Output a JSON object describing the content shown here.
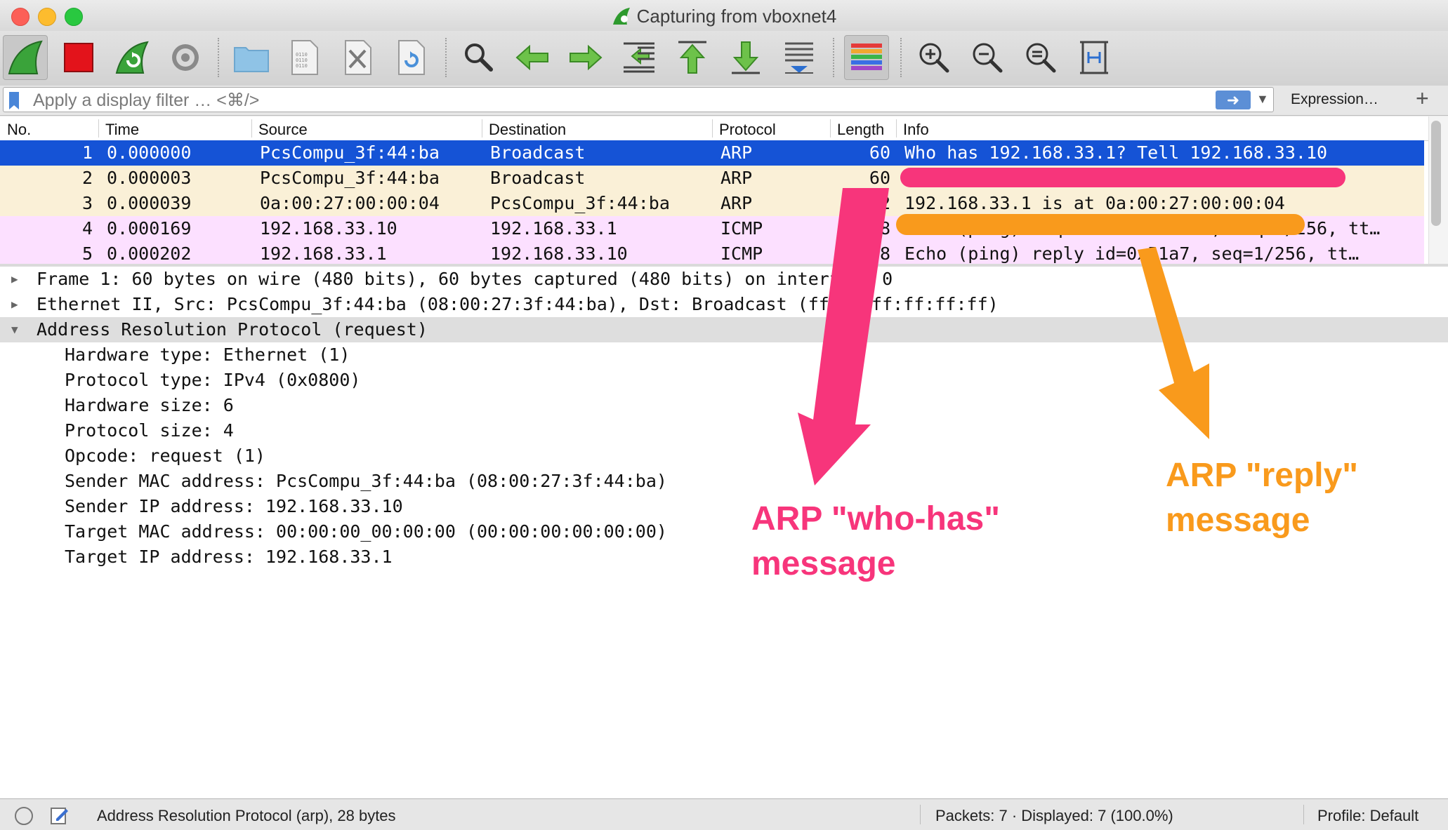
{
  "window": {
    "title": "Capturing from vboxnet4"
  },
  "toolbar": {
    "buttons": [
      "start-capture",
      "stop-capture",
      "restart-capture",
      "capture-options",
      "open-file",
      "save-file",
      "close-file",
      "reload-file",
      "find-packet",
      "go-back",
      "go-forward",
      "go-to-packet",
      "go-to-first",
      "go-to-last",
      "autoscroll",
      "colorize",
      "zoom-in",
      "zoom-out",
      "zoom-normal",
      "resize-columns"
    ]
  },
  "filter": {
    "placeholder": "Apply a display filter … <⌘/>",
    "expression_label": "Expression…",
    "add_label": "+"
  },
  "packet_list": {
    "columns": [
      "No.",
      "Time",
      "Source",
      "Destination",
      "Protocol",
      "Length",
      "Info"
    ],
    "rows": [
      {
        "no": "1",
        "time": "0.000000",
        "source": "PcsCompu_3f:44:ba",
        "destination": "Broadcast",
        "protocol": "ARP",
        "length": "60",
        "info": "Who has 192.168.33.1? Tell 192.168.33.10"
      },
      {
        "no": "2",
        "time": "0.000003",
        "source": "PcsCompu_3f:44:ba",
        "destination": "Broadcast",
        "protocol": "ARP",
        "length": "60",
        "info": ""
      },
      {
        "no": "3",
        "time": "0.000039",
        "source": "0a:00:27:00:00:04",
        "destination": "PcsCompu_3f:44:ba",
        "protocol": "ARP",
        "length": "42",
        "info": "192.168.33.1 is at 0a:00:27:00:00:04"
      },
      {
        "no": "4",
        "time": "0.000169",
        "source": "192.168.33.10",
        "destination": "192.168.33.1",
        "protocol": "ICMP",
        "length": "98",
        "info": "Echo (ping) request  id=0x51a7, seq=1/256, tt…"
      },
      {
        "no": "5",
        "time": "0.000202",
        "source": "192.168.33.1",
        "destination": "192.168.33.10",
        "protocol": "ICMP",
        "length": "98",
        "info": "Echo (ping) reply    id=0x51a7, seq=1/256, tt…"
      }
    ]
  },
  "details": {
    "frame": "Frame 1: 60 bytes on wire (480 bits), 60 bytes captured (480 bits) on interface 0",
    "ethernet": "Ethernet II, Src: PcsCompu_3f:44:ba (08:00:27:3f:44:ba), Dst: Broadcast (ff:ff:ff:ff:ff:ff)",
    "arp": "Address Resolution Protocol (request)",
    "fields": [
      "Hardware type: Ethernet (1)",
      "Protocol type: IPv4 (0x0800)",
      "Hardware size: 6",
      "Protocol size: 4",
      "Opcode: request (1)",
      "Sender MAC address: PcsCompu_3f:44:ba (08:00:27:3f:44:ba)",
      "Sender IP address: 192.168.33.10",
      "Target MAC address: 00:00:00_00:00:00 (00:00:00:00:00:00)",
      "Target IP address: 192.168.33.1"
    ]
  },
  "status": {
    "protocol_text": "Address Resolution Protocol (arp), 28 bytes",
    "packets_text": "Packets: 7 · Displayed: 7 (100.0%)",
    "profile_text": "Profile: Default"
  },
  "annotations": {
    "who_has_line1": "ARP \"who-has\"",
    "who_has_line2": "message",
    "reply_line1": "ARP \"reply\"",
    "reply_line2": "message",
    "pink_color": "#f7357b",
    "orange_color": "#f99a1c"
  },
  "colors": {
    "selected_row": "#1553d6",
    "arp_row": "#faf0d7",
    "icmp_row": "#fce0ff"
  }
}
